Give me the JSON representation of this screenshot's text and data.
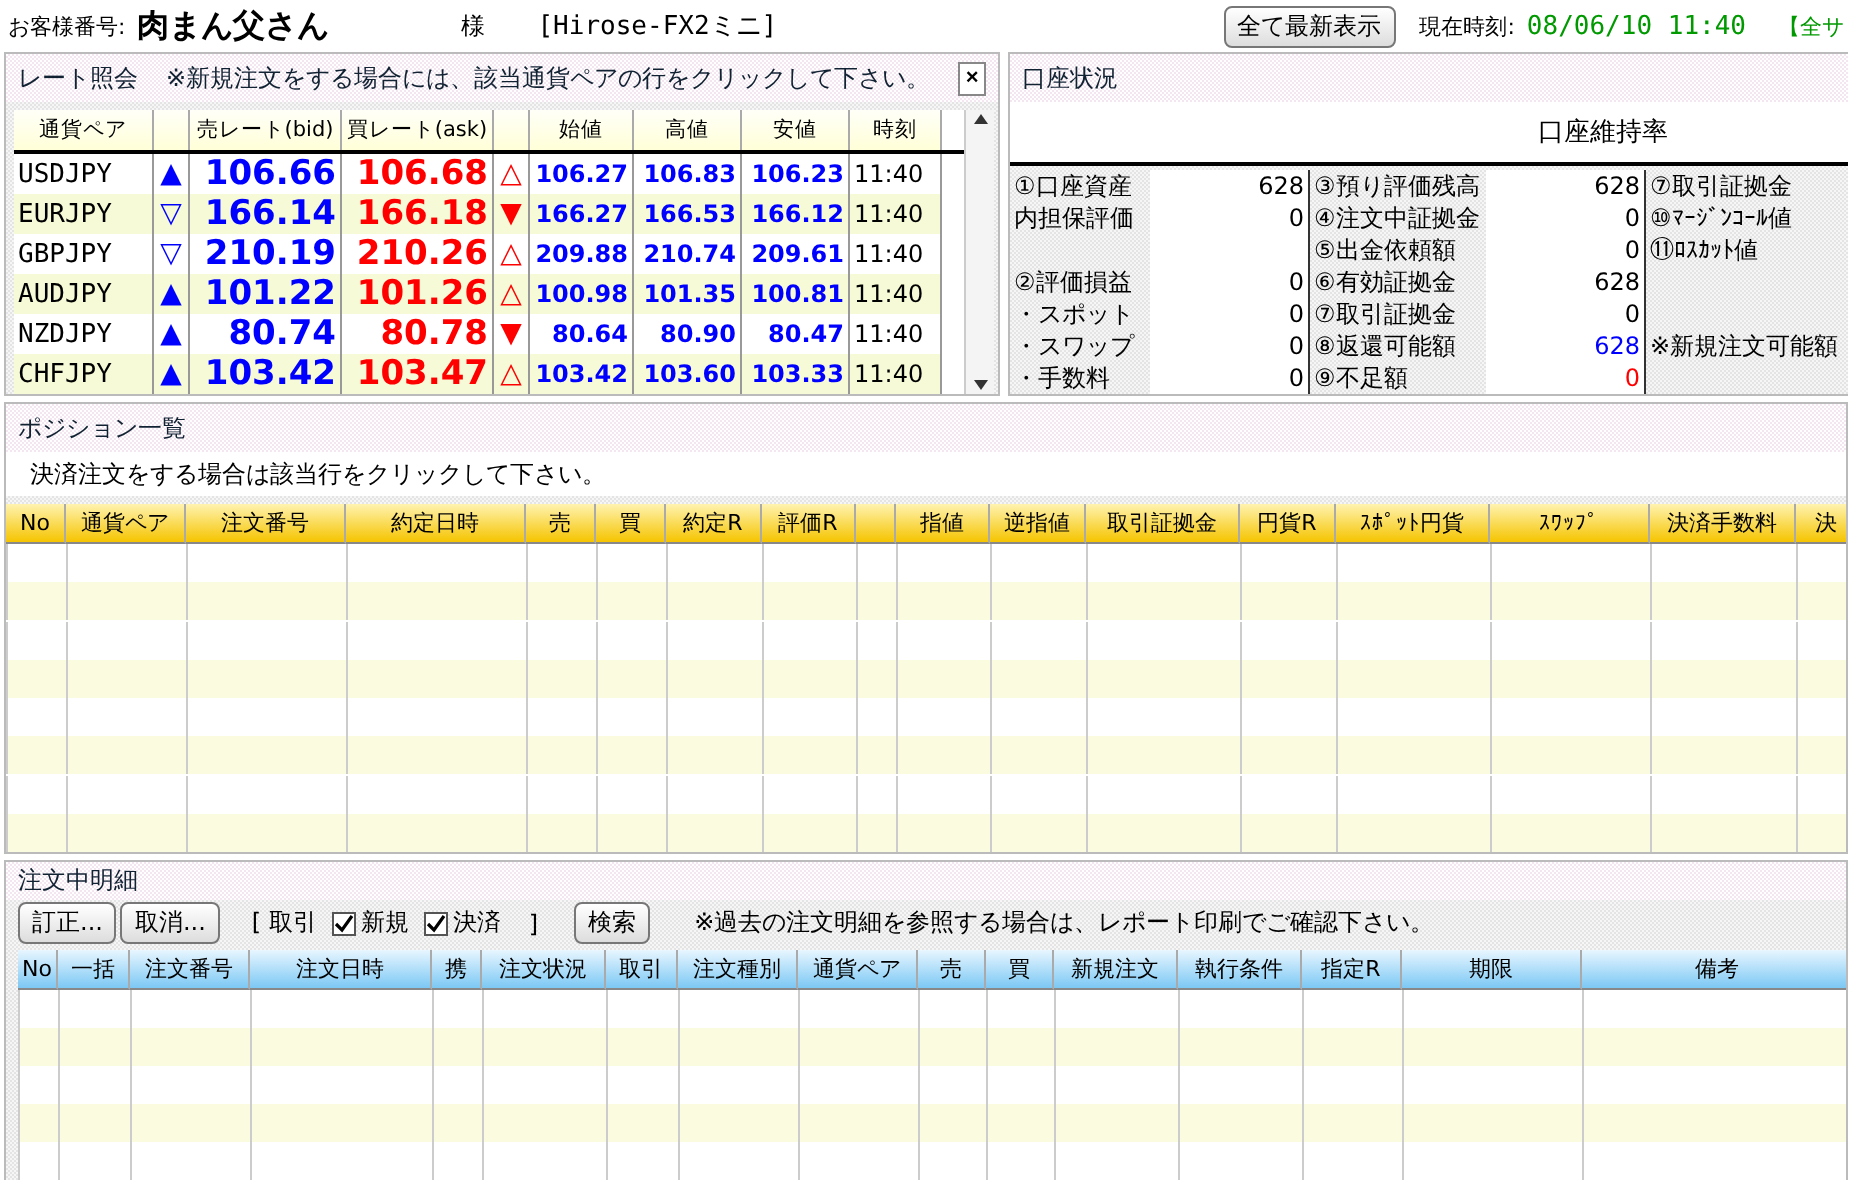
{
  "header": {
    "customer_label": "お客様番号:",
    "customer_name": "肉まん父さん",
    "honorific": "様",
    "product": "[Hirose-FX2ミニ]",
    "refresh_button": "全て最新表示",
    "time_label": "現在時刻:",
    "time_value": "08/06/10 11:40",
    "notice": "【全サ"
  },
  "rates": {
    "title": "レート照会",
    "note": "※新規注文をする場合には、該当通貨ペアの行をクリックして下さい。",
    "close": "×",
    "columns": [
      "通貨ペア",
      "売レート(bid)",
      "買レート(ask)",
      "始値",
      "高値",
      "安値",
      "時刻"
    ],
    "rows": [
      {
        "pair": "USDJPY",
        "bid_trend": "▲",
        "bid": "106.66",
        "ask": "106.68",
        "ask_trend": "△",
        "open": "106.27",
        "high": "106.83",
        "low": "106.23",
        "time": "11:40"
      },
      {
        "pair": "EURJPY",
        "bid_trend": "▽",
        "bid": "166.14",
        "ask": "166.18",
        "ask_trend": "▼",
        "open": "166.27",
        "high": "166.53",
        "low": "166.12",
        "time": "11:40"
      },
      {
        "pair": "GBPJPY",
        "bid_trend": "▽",
        "bid": "210.19",
        "ask": "210.26",
        "ask_trend": "△",
        "open": "209.88",
        "high": "210.74",
        "low": "209.61",
        "time": "11:40"
      },
      {
        "pair": "AUDJPY",
        "bid_trend": "▲",
        "bid": "101.22",
        "ask": "101.26",
        "ask_trend": "△",
        "open": "100.98",
        "high": "101.35",
        "low": "100.81",
        "time": "11:40"
      },
      {
        "pair": "NZDJPY",
        "bid_trend": "▲",
        "bid": "80.74",
        "ask": "80.78",
        "ask_trend": "▼",
        "open": "80.64",
        "high": "80.90",
        "low": "80.47",
        "time": "11:40"
      },
      {
        "pair": "CHFJPY",
        "bid_trend": "▲",
        "bid": "103.42",
        "ask": "103.47",
        "ask_trend": "△",
        "open": "103.42",
        "high": "103.60",
        "low": "103.33",
        "time": "11:40"
      }
    ]
  },
  "account": {
    "title": "口座状況",
    "ratio_label": "口座維持率",
    "rows": [
      {
        "label_1": "①口座資産",
        "value_1": "628",
        "label_2": "③預り評価残高",
        "value_2": "628",
        "label_3": "⑦取引証拠金"
      },
      {
        "label_1": "内担保評価",
        "value_1": "0",
        "label_2": "④注文中証拠金",
        "value_2": "0",
        "label_3": "⑩ﾏｰｼﾞﾝｺｰﾙ値"
      },
      {
        "label_2": "⑤出金依頼額",
        "value_2": "0",
        "label_3": "⑪ﾛｽｶｯﾄ値"
      },
      {
        "label_1": "②評価損益",
        "value_1": "0",
        "label_2": "⑥有効証拠金",
        "value_2": "628"
      },
      {
        "label_1": "・スポット",
        "value_1": "0",
        "label_2": "⑦取引証拠金",
        "value_2": "0"
      },
      {
        "label_1": "・スワップ",
        "value_1": "0",
        "label_2": "⑧返還可能額",
        "value_2": "628",
        "color": "#0000ff",
        "label_3": "※新規注文可能額"
      },
      {
        "label_1": "・手数料",
        "value_1": "0",
        "label_2": "⑨不足額",
        "value_2": "0",
        "color": "#ff0000"
      }
    ]
  },
  "positions": {
    "title": "ポジション一覧",
    "note": "決済注文をする場合は該当行をクリックして下さい。",
    "columns": [
      "No",
      "通貨ペア",
      "注文番号",
      "約定日時",
      "売",
      "買",
      "約定R",
      "評価R",
      null,
      "指値",
      "逆指値",
      "取引証拠金",
      "円貨R",
      "ｽﾎﾟｯﾄ円貨",
      "ｽﾜｯﾌﾟ",
      "決済手数料",
      "決"
    ]
  },
  "orders": {
    "title": "注文中明細",
    "buttons": [
      "訂正...",
      "取消..."
    ],
    "filter_open": "[ 取引",
    "filters": [
      {
        "label": "新規",
        "checked": true
      },
      {
        "label": "決済",
        "checked": true
      }
    ],
    "filter_close": "]",
    "search_button": "検索",
    "note": "※過去の注文明細を参照する場合は、レポート印刷でご確認下さい。",
    "columns": [
      "No",
      "一括",
      "注文番号",
      "注文日時",
      "携",
      "注文状況",
      "取引",
      "注文種別",
      "通貨ペア",
      "売",
      "買",
      "新規注文",
      "執行条件",
      "指定R",
      "期限",
      "備考"
    ]
  }
}
